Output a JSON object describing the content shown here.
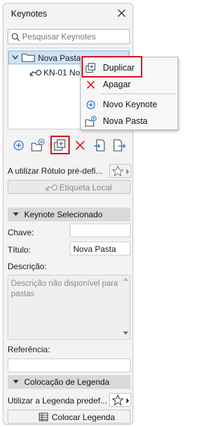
{
  "window": {
    "title": "Keynotes"
  },
  "search": {
    "placeholder": "Pesquisar Keynotes"
  },
  "tree": {
    "folder_label": "Nova Pasta",
    "child_label": "KN-01 Nova"
  },
  "context_menu": {
    "items": [
      {
        "label": "Duplicar",
        "icon": "duplicate-icon"
      },
      {
        "label": "Apagar",
        "icon": "delete-x-icon"
      },
      {
        "label": "Novo Keynote",
        "icon": "add-circle-icon"
      },
      {
        "label": "Nova Pasta",
        "icon": "new-folder-icon"
      }
    ]
  },
  "toolbar": {
    "buttons": [
      "add-keynote-icon",
      "new-folder-icon",
      "duplicate-icon",
      "delete-icon",
      "import-icon",
      "export-icon"
    ]
  },
  "label_settings": {
    "using_text": "A utilizar Rótulo pré-defi...",
    "local_label_button": "Etiqueta Local"
  },
  "selected_section": {
    "title": "Keynote Selecionado",
    "key_label": "Chave:",
    "key_value": "",
    "title_label": "Título:",
    "title_value": "Nova Pasta",
    "description_label": "Descrição:",
    "description_placeholder": "Descrição não disponível para pastas",
    "reference_label": "Referência:",
    "reference_value": ""
  },
  "legend_section": {
    "title": "Colocação de Legenda",
    "using_text": "Utilizar a Legenda predef...",
    "place_button": "Colocar Legenda"
  },
  "colors": {
    "highlight_red": "#d8121c",
    "accent_blue": "#2a6fd6",
    "selection_bg": "#cde3f7"
  }
}
